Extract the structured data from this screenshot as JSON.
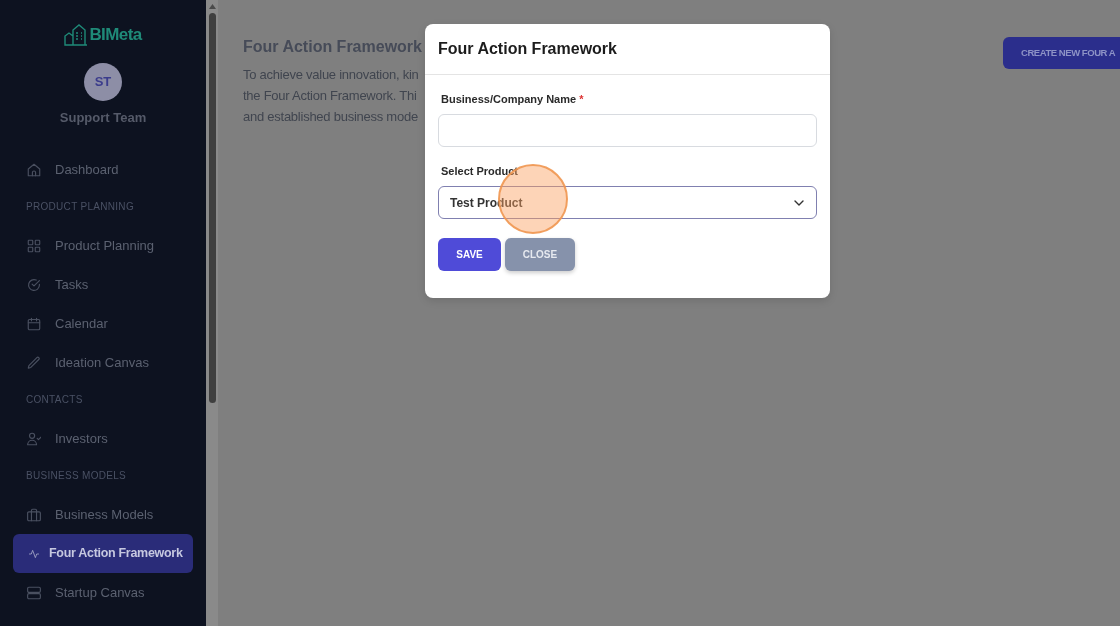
{
  "sidebar": {
    "logo_text": "BIMeta",
    "user": {
      "initials": "ST",
      "name": "Support Team"
    },
    "items": [
      {
        "kind": "link",
        "label": "Dashboard",
        "selected": false
      },
      {
        "kind": "section",
        "label": "PRODUCT PLANNING"
      },
      {
        "kind": "link",
        "label": "Product Planning",
        "selected": false
      },
      {
        "kind": "link",
        "label": "Tasks",
        "selected": false
      },
      {
        "kind": "link",
        "label": "Calendar",
        "selected": false
      },
      {
        "kind": "link",
        "label": "Ideation Canvas",
        "selected": false
      },
      {
        "kind": "section",
        "label": "CONTACTS"
      },
      {
        "kind": "link",
        "label": "Investors",
        "selected": false
      },
      {
        "kind": "section",
        "label": "BUSINESS MODELS"
      },
      {
        "kind": "link",
        "label": "Business Models",
        "selected": false
      },
      {
        "kind": "link",
        "label": "Four Action Framework",
        "selected": true
      },
      {
        "kind": "link",
        "label": "Startup Canvas",
        "selected": false
      }
    ]
  },
  "page": {
    "title": "Four Action Framework",
    "intro_lines": [
      "To achieve value innovation, kin",
      "the Four Action Framework. Thi",
      "and established business mode"
    ],
    "action_button": "CREATE NEW FOUR A"
  },
  "modal": {
    "title": "Four Action Framework",
    "fields": [
      {
        "kind": "text",
        "label": "Business/Company Name",
        "required_mark": "*"
      },
      {
        "kind": "select",
        "label": "Select Product",
        "value": "Test Product"
      }
    ],
    "buttons": [
      {
        "kind": "primary",
        "label": "SAVE"
      },
      {
        "kind": "secondary",
        "label": "CLOSE"
      }
    ]
  }
}
